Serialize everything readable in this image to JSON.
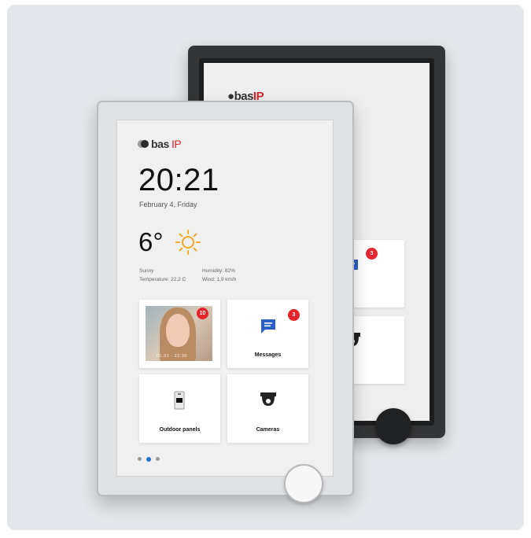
{
  "back_device": {
    "logo_text": "bas",
    "logo_ip": "IP",
    "tiles": {
      "messages_label": "Messages",
      "messages_badge": "3",
      "cameras_label": "Cameras"
    }
  },
  "front_device": {
    "logo_text": "bas",
    "logo_ip": "IP",
    "time": "20:21",
    "date": "February 4, Friday",
    "temperature": "6°",
    "weather_icon": "sun-icon",
    "condition": "Sunny",
    "temperature_detail": "Temperature: 22,2 C",
    "humidity": "Humidity: 82%",
    "wind": "Wind: 1,9 km/h",
    "tiles": {
      "visitor_badge": "10",
      "visitor_caption": "01.01 - 22:30",
      "messages_label": "Messages",
      "messages_badge": "3",
      "outdoor_label": "Outdoor panels",
      "cameras_label": "Cameras"
    },
    "pager": {
      "count": 3,
      "active_index": 1
    }
  },
  "colors": {
    "accent_blue": "#1f74c9",
    "badge_red": "#e5252b",
    "brand_red": "#d6262b",
    "sun_orange": "#f5a623"
  }
}
